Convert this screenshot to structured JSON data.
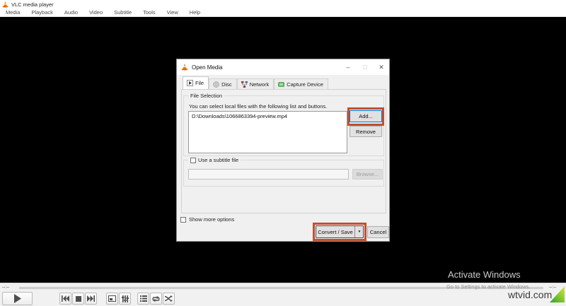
{
  "window": {
    "title": "VLC media player"
  },
  "menu": {
    "items": [
      "Media",
      "Playback",
      "Audio",
      "Video",
      "Subtitle",
      "Tools",
      "View",
      "Help"
    ]
  },
  "dialog": {
    "title": "Open Media",
    "window_controls": {
      "minimize": "–",
      "maximize": "□",
      "close": "✕"
    },
    "tabs": {
      "file": "File",
      "disc": "Disc",
      "network": "Network",
      "capture": "Capture Device"
    },
    "file_selection": {
      "legend": "File Selection",
      "hint": "You can select local files with the following list and buttons.",
      "file": "D:\\Downloads\\1066863394-preview.mp4",
      "add": "Add...",
      "remove": "Remove"
    },
    "subtitle": {
      "legend": "Use a subtitle file",
      "value": "",
      "browse": "Browse..."
    },
    "show_more": "Show more options",
    "convert_save": "Convert / Save",
    "dropdown_glyph": "▼",
    "cancel": "Cancel"
  },
  "player": {
    "time_elapsed": "--:--",
    "time_remaining": "--:--"
  },
  "watermark": {
    "line1": "Activate Windows",
    "line2": "Go to Settings to activate Windows.",
    "brand": "wtvid.com"
  },
  "colors": {
    "annotation_highlight": "#c0512f",
    "accent_blue": "#0078d7",
    "vlc_orange": "#f07e13",
    "brand_green": "#2fa12b",
    "brand_yellow": "#d8e83a"
  },
  "icons": {
    "vlc_cone": "orange traffic cone",
    "tab_file": "play-in-box",
    "tab_disc": "optical disc",
    "tab_network": "network nodes",
    "tab_capture": "capture card",
    "play": "play triangle",
    "previous": "skip back",
    "stop": "stop square",
    "next": "skip forward",
    "fullscreen": "frame",
    "equalizer": "vertical sliders",
    "playlist": "list",
    "loop": "cycle arrows",
    "shuffle": "crossed arrows"
  }
}
